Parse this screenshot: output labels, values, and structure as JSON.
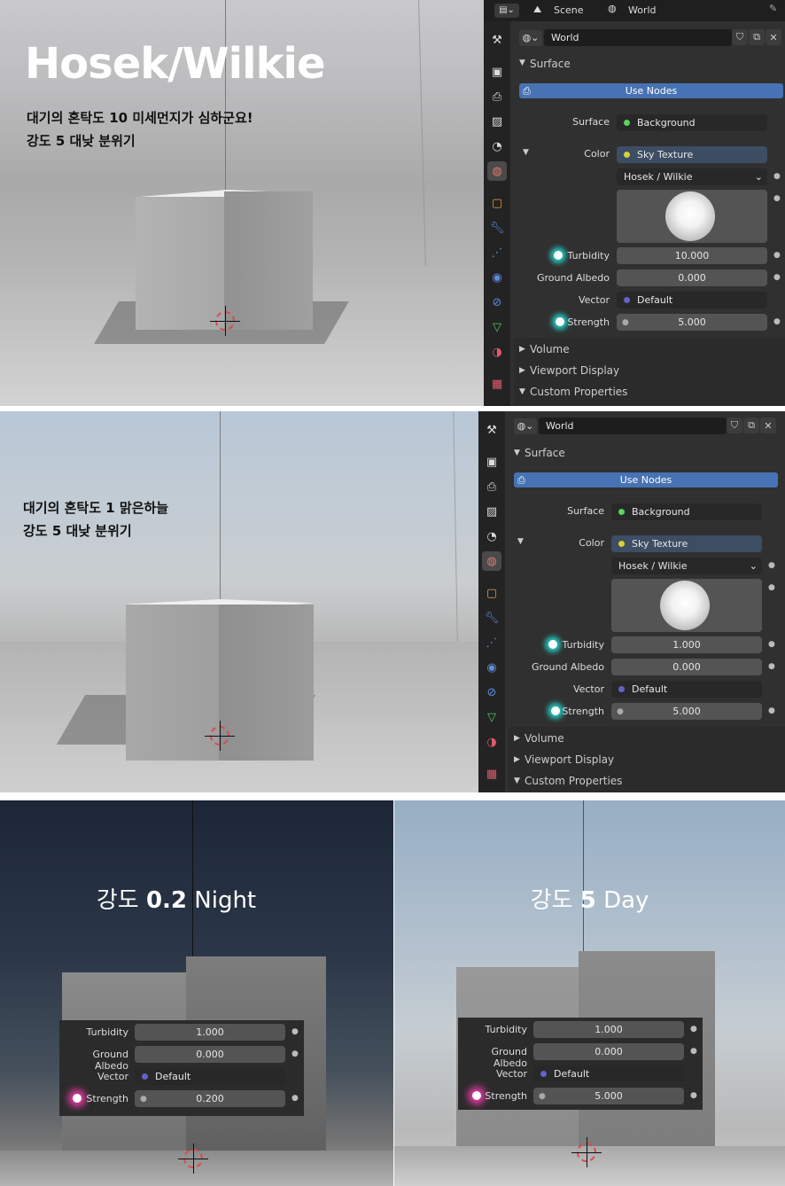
{
  "section1": {
    "title": "Hosek/Wilkie",
    "line1": "대기의 혼탁도 10 미세먼지가 심하군요!",
    "line2": "강도 5 대낮 분위기",
    "topbar": {
      "scene": "Scene",
      "world": "World"
    },
    "world_name": "World",
    "surface_header": "Surface",
    "use_nodes": "Use Nodes",
    "surface_label": "Surface",
    "surface_value": "Background",
    "color_label": "Color",
    "color_value": "Sky Texture",
    "sky_type": "Hosek / Wilkie",
    "turbidity_label": "Turbidity",
    "turbidity": "10.000",
    "albedo_label": "Ground Albedo",
    "albedo": "0.000",
    "vector_label": "Vector",
    "vector": "Default",
    "strength_label": "Strength",
    "strength": "5.000",
    "volume": "Volume",
    "viewport_display": "Viewport Display",
    "custom_props": "Custom Properties"
  },
  "section2": {
    "line1": "대기의 혼탁도 1 맑은하늘",
    "line2": "강도 5 대낮 분위기",
    "world_name": "World",
    "surface_header": "Surface",
    "use_nodes": "Use Nodes",
    "surface_label": "Surface",
    "surface_value": "Background",
    "color_label": "Color",
    "color_value": "Sky Texture",
    "sky_type": "Hosek / Wilkie",
    "turbidity_label": "Turbidity",
    "turbidity": "1.000",
    "albedo_label": "Ground Albedo",
    "albedo": "0.000",
    "vector_label": "Vector",
    "vector": "Default",
    "strength_label": "Strength",
    "strength": "5.000",
    "volume": "Volume",
    "viewport_display": "Viewport Display",
    "custom_props": "Custom Properties"
  },
  "night": {
    "title_prefix": "강도",
    "title_value": "0.2",
    "title_suffix": "Night",
    "turbidity_label": "Turbidity",
    "turbidity": "1.000",
    "albedo_label": "Ground Albedo",
    "albedo": "0.000",
    "vector_label": "Vector",
    "vector": "Default",
    "strength_label": "Strength",
    "strength": "0.200"
  },
  "day": {
    "title_prefix": "강도",
    "title_value": "5",
    "title_suffix": "Day",
    "turbidity_label": "Turbidity",
    "turbidity": "1.000",
    "albedo_label": "Ground Albedo",
    "albedo": "0.000",
    "vector_label": "Vector",
    "vector": "Default",
    "strength_label": "Strength",
    "strength": "5.000"
  },
  "colors": {
    "accent_blue": "#4772b3",
    "glow_teal": "#26c6bf",
    "glow_pink": "#e23ba3",
    "color_socket": "#d6d03a",
    "shader_socket": "#5bd35b",
    "vector_socket": "#6363c7"
  },
  "tab_icons": [
    "tool-icon",
    "render-icon",
    "output-icon",
    "view-layer-icon",
    "scene-icon",
    "world-icon",
    "object-icon",
    "modifier-icon",
    "particles-icon",
    "physics-icon",
    "constraints-icon",
    "data-icon",
    "material-icon",
    "texture-icon"
  ]
}
